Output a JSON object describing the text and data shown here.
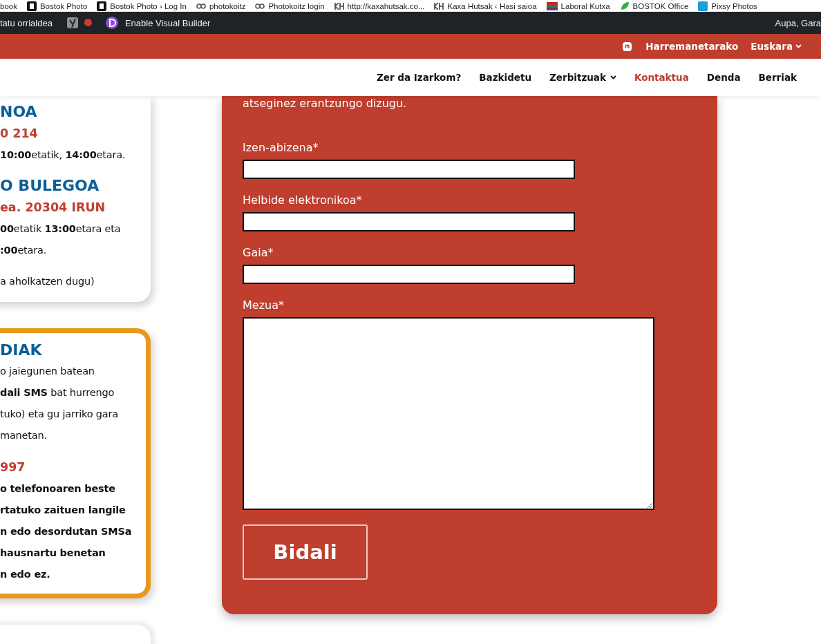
{
  "bookmarks": [
    {
      "label": "book",
      "kind": "none"
    },
    {
      "label": "Bostok Photo",
      "kind": "bostok"
    },
    {
      "label": "Bostok Photo › Log In",
      "kind": "bostok"
    },
    {
      "label": "photokoitz",
      "kind": "gg"
    },
    {
      "label": "Photokoitz login",
      "kind": "gg"
    },
    {
      "label": "http://kaxahutsak.co...",
      "kind": "kh"
    },
    {
      "label": "Kaxa Hutsak ‹ Hasi saioa",
      "kind": "kh"
    },
    {
      "label": "Laboral Kutxa",
      "kind": "flag"
    },
    {
      "label": "BOSTOK Office",
      "kind": "leaf"
    },
    {
      "label": "Pixsy Photos",
      "kind": "pixsy"
    }
  ],
  "admin_bar": {
    "page_link": "tatu orrialdea",
    "builder": "Enable Visual Builder",
    "greeting": "Aupa, Gara"
  },
  "top_bar": {
    "links": [
      {
        "label": "Harremanetarako",
        "dropdown": false
      },
      {
        "label": "Euskara",
        "dropdown": true
      }
    ]
  },
  "nav": [
    {
      "label": "Zer da Izarkom?",
      "selected": false,
      "dropdown": false
    },
    {
      "label": "Bazkidetu",
      "selected": false,
      "dropdown": false
    },
    {
      "label": "Zerbitzuak",
      "selected": false,
      "dropdown": true
    },
    {
      "label": "Kontaktua",
      "selected": true,
      "dropdown": false
    },
    {
      "label": "Denda",
      "selected": false,
      "dropdown": false
    },
    {
      "label": "Berriak",
      "selected": false,
      "dropdown": false
    }
  ],
  "info_cards": [
    {
      "kind": "plain",
      "sections": [
        [
          {
            "kind": "heading",
            "text": "NOA"
          },
          {
            "kind": "subheading",
            "text": "0 214"
          },
          {
            "kind": "text",
            "text": "**10:00**etatik, **14:00**etara."
          }
        ],
        [
          {
            "kind": "heading",
            "text": "O BULEGOA"
          },
          {
            "kind": "subheading",
            "text": "ea. 20304 IRUN"
          },
          {
            "kind": "text",
            "text": "**00**etatik **13:00**etara eta"
          },
          {
            "kind": "text",
            "text": "**:00**etara."
          }
        ],
        [
          {
            "kind": "text",
            "text": "a aholkatzen dugu)"
          }
        ]
      ]
    },
    {
      "kind": "highlighted",
      "sections": [
        [
          {
            "kind": "heading",
            "text": "DIAK"
          },
          {
            "kind": "text",
            "text": "o jaiegunen batean"
          },
          {
            "kind": "text",
            "text": "**dali SMS** bat hurrengo"
          },
          {
            "kind": "text",
            "text": "tuko) eta gu jarriko gara"
          },
          {
            "kind": "text",
            "text": "manetan."
          }
        ],
        [
          {
            "kind": "subheading",
            "text": "997"
          },
          {
            "kind": "bold",
            "text": "o telefonoaren beste"
          },
          {
            "kind": "bold",
            "text": "rtatuko zaituen langile"
          },
          {
            "kind": "bold",
            "text": "n edo desordutan SMSa"
          },
          {
            "kind": "bold",
            "text": "hausnartu benetan"
          },
          {
            "kind": "bold",
            "text": "n edo ez."
          }
        ]
      ]
    }
  ],
  "form": {
    "intro": "atseginez erantzungo dizugu.",
    "fields": [
      {
        "label": "Izen-abizena*",
        "kind": "input"
      },
      {
        "label": "Helbide elektronikoa*",
        "kind": "input"
      },
      {
        "label": "Gaia*",
        "kind": "input"
      },
      {
        "label": "Mezua*",
        "kind": "textarea"
      }
    ],
    "submit": "Bidali"
  }
}
